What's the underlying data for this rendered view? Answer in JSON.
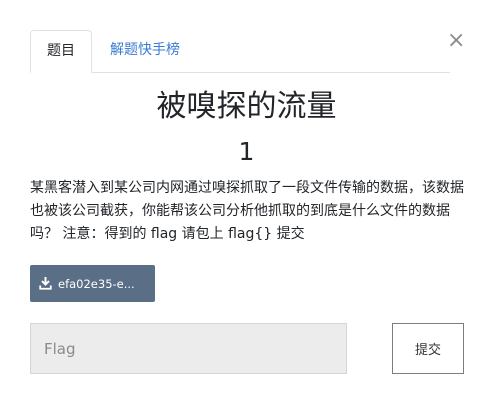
{
  "tabs": [
    {
      "label": "题目"
    },
    {
      "label": "解题快手榜"
    }
  ],
  "close_label": "×",
  "challenge": {
    "title": "被嗅探的流量",
    "score": "1",
    "description": "某黑客潜入到某公司内网通过嗅探抓取了一段文件传输的数据，该数据也被该公司截获，你能帮该公司分析他抓取的到底是什么文件的数据吗？ 注意：得到的 flag 请包上 flag{} 提交",
    "attachment_label": "efa02e35-e...",
    "attachment_icon": "download-icon"
  },
  "flag_input": {
    "placeholder": "Flag",
    "value": ""
  },
  "submit_label": "提交",
  "colors": {
    "tab_link": "#3a7bd5",
    "download_button": "#5a6f86",
    "input_background": "#ececec"
  }
}
